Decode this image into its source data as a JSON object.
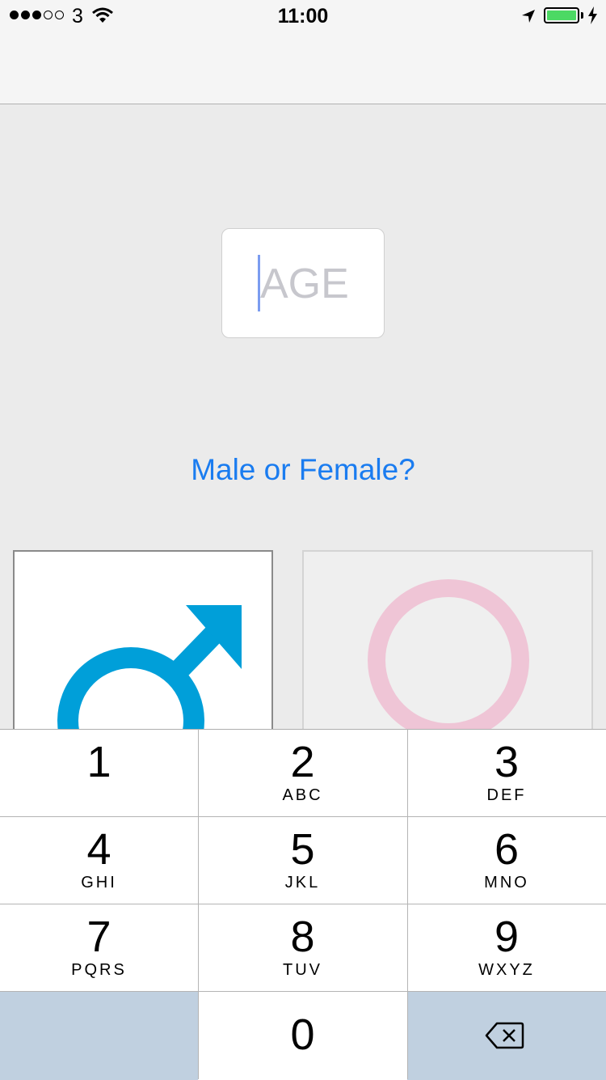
{
  "status_bar": {
    "carrier": "3",
    "time": "11:00",
    "signal_bars": 5,
    "signal_filled": 3,
    "battery_color": "#4cd964"
  },
  "form": {
    "age_placeholder": "AGE",
    "age_value": "",
    "gender_prompt": "Male or Female?",
    "male_icon": "male-symbol-icon",
    "female_icon": "female-symbol-icon",
    "male_color": "#009fd9",
    "female_color": "#efc5d6"
  },
  "keypad": {
    "keys": [
      {
        "num": "1",
        "letters": ""
      },
      {
        "num": "2",
        "letters": "ABC"
      },
      {
        "num": "3",
        "letters": "DEF"
      },
      {
        "num": "4",
        "letters": "GHI"
      },
      {
        "num": "5",
        "letters": "JKL"
      },
      {
        "num": "6",
        "letters": "MNO"
      },
      {
        "num": "7",
        "letters": "PQRS"
      },
      {
        "num": "8",
        "letters": "TUV"
      },
      {
        "num": "9",
        "letters": "WXYZ"
      },
      {
        "num": "0",
        "letters": ""
      }
    ],
    "delete_icon": "backspace-icon",
    "special_key_color": "#c0d0e0"
  }
}
